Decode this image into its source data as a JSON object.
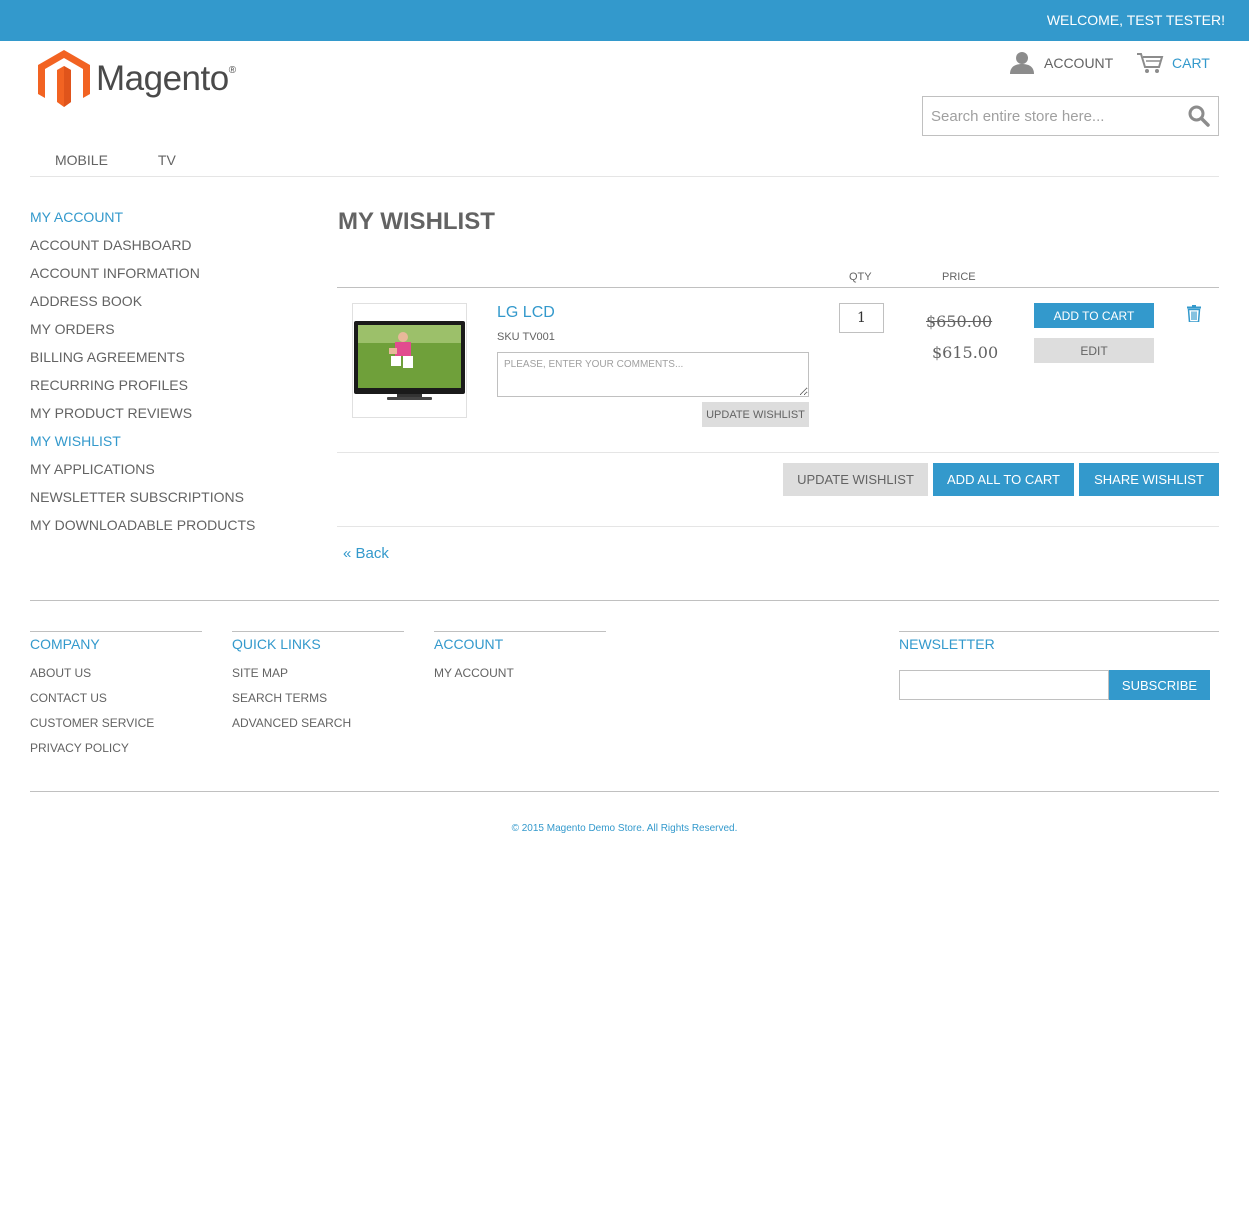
{
  "header": {
    "welcome": "WELCOME, TEST TESTER!",
    "logo_text": "Magento",
    "logo_reg": "®",
    "account_label": "ACCOUNT",
    "cart_label": "CART",
    "search_placeholder": "Search entire store here..."
  },
  "nav": {
    "items": [
      {
        "label": "MOBILE"
      },
      {
        "label": "TV"
      }
    ]
  },
  "sidebar": {
    "title": "MY ACCOUNT",
    "items": [
      {
        "label": "ACCOUNT DASHBOARD"
      },
      {
        "label": "ACCOUNT INFORMATION"
      },
      {
        "label": "ADDRESS BOOK"
      },
      {
        "label": "MY ORDERS"
      },
      {
        "label": "BILLING AGREEMENTS"
      },
      {
        "label": "RECURRING PROFILES"
      },
      {
        "label": "MY PRODUCT REVIEWS"
      },
      {
        "label": "MY WISHLIST"
      },
      {
        "label": "MY APPLICATIONS"
      },
      {
        "label": "NEWSLETTER SUBSCRIPTIONS"
      },
      {
        "label": "MY DOWNLOADABLE PRODUCTS"
      }
    ],
    "current_index": 7
  },
  "wishlist": {
    "title": "MY WISHLIST",
    "col_qty": "QTY",
    "col_price": "PRICE",
    "item": {
      "name": "LG LCD",
      "sku": "SKU TV001",
      "comment_placeholder": "PLEASE, ENTER YOUR COMMENTS...",
      "qty": "1",
      "old_price": "$650.00",
      "new_price": "$615.00",
      "add_to_cart": "ADD TO CART",
      "edit": "EDIT",
      "update_small": "UPDATE WISHLIST"
    },
    "buttons": {
      "update": "UPDATE WISHLIST",
      "add_all": "ADD ALL TO CART",
      "share": "SHARE WISHLIST"
    },
    "back": "« Back"
  },
  "footer": {
    "company": {
      "title": "COMPANY",
      "links": [
        "ABOUT US",
        "CONTACT US",
        "CUSTOMER SERVICE",
        "PRIVACY POLICY"
      ]
    },
    "quick_links": {
      "title": "QUICK LINKS",
      "links": [
        "SITE MAP",
        "SEARCH TERMS",
        "ADVANCED SEARCH"
      ]
    },
    "account": {
      "title": "ACCOUNT",
      "links": [
        "MY ACCOUNT"
      ]
    },
    "newsletter": {
      "title": "NEWSLETTER",
      "subscribe": "SUBSCRIBE"
    },
    "copyright": "© 2015 Magento Demo Store. All Rights Reserved."
  },
  "colors": {
    "accent": "#3399cc",
    "text": "#636363",
    "button_gray": "#dddddd",
    "logo_orange": "#f26322"
  },
  "icons": [
    "magento-logo-icon",
    "user-icon",
    "cart-icon",
    "search-icon",
    "trash-icon"
  ]
}
